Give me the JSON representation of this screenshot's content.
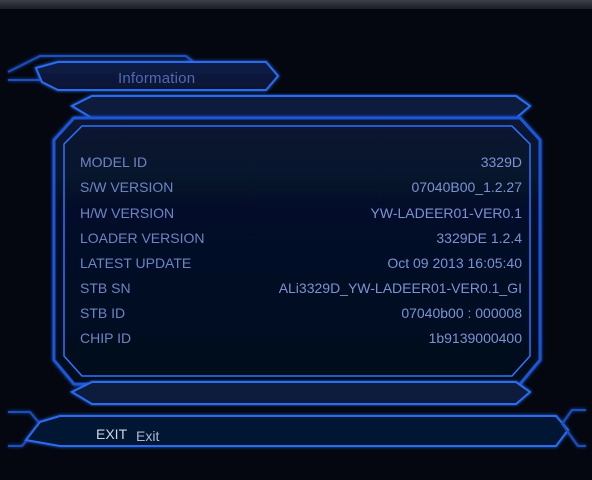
{
  "header": {
    "title": "Information"
  },
  "info": {
    "rows": [
      {
        "label": "MODEL ID",
        "value": "3329D"
      },
      {
        "label": "S/W VERSION",
        "value": "07040B00_1.2.27"
      },
      {
        "label": "H/W VERSION",
        "value": "YW-LADEER01-VER0.1"
      },
      {
        "label": "LOADER VERSION",
        "value": "3329DE 1.2.4"
      },
      {
        "label": "LATEST UPDATE",
        "value": "Oct 09 2013 16:05:40"
      },
      {
        "label": "STB SN",
        "value": "ALi3329D_YW-LADEER01-VER0.1_GI"
      },
      {
        "label": "STB ID",
        "value": "07040b00 : 000008"
      },
      {
        "label": "CHIP ID",
        "value": "1b9139000400"
      }
    ]
  },
  "footer": {
    "key": "EXIT",
    "action": "Exit"
  },
  "colors": {
    "background": "#04070f",
    "frame": "#1e5fd6",
    "glow": "#3d8bff",
    "text": "#6f88c8"
  }
}
